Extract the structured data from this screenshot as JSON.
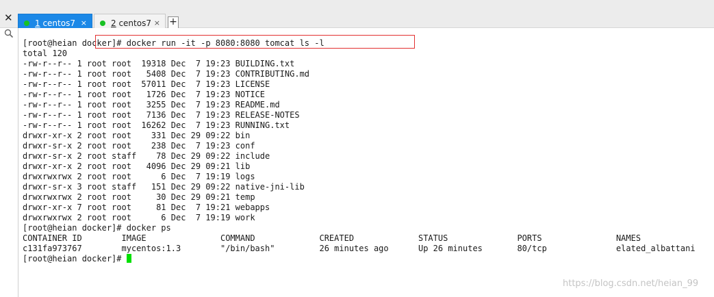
{
  "tabs": [
    {
      "num": "1",
      "name": " centos7",
      "close": "×"
    },
    {
      "num": "2",
      "name": " centos7",
      "close": "×"
    }
  ],
  "add_tab_label": "+",
  "close_panel_label": "✕",
  "icons": {
    "search": "search-icon"
  },
  "prompt": "[root@heian docker]# ",
  "command1": "docker run -it -p 8080:8080 tomcat ls -l",
  "total": "total 120",
  "listing": [
    "-rw-r--r-- 1 root root  19318 Dec  7 19:23 BUILDING.txt",
    "-rw-r--r-- 1 root root   5408 Dec  7 19:23 CONTRIBUTING.md",
    "-rw-r--r-- 1 root root  57011 Dec  7 19:23 LICENSE",
    "-rw-r--r-- 1 root root   1726 Dec  7 19:23 NOTICE",
    "-rw-r--r-- 1 root root   3255 Dec  7 19:23 README.md",
    "-rw-r--r-- 1 root root   7136 Dec  7 19:23 RELEASE-NOTES",
    "-rw-r--r-- 1 root root  16262 Dec  7 19:23 RUNNING.txt",
    "drwxr-xr-x 2 root root    331 Dec 29 09:22 bin",
    "drwxr-sr-x 2 root root    238 Dec  7 19:23 conf",
    "drwxr-sr-x 2 root staff    78 Dec 29 09:22 include",
    "drwxr-xr-x 2 root root   4096 Dec 29 09:21 lib",
    "drwxrwxrwx 2 root root      6 Dec  7 19:19 logs",
    "drwxr-sr-x 3 root staff   151 Dec 29 09:22 native-jni-lib",
    "drwxrwxrwx 2 root root     30 Dec 29 09:21 temp",
    "drwxr-xr-x 7 root root     81 Dec  7 19:21 webapps",
    "drwxrwxrwx 2 root root      6 Dec  7 19:19 work"
  ],
  "command2": "docker ps",
  "ps_header": "CONTAINER ID        IMAGE               COMMAND             CREATED             STATUS              PORTS               NAMES",
  "ps_row": "c131fa973767        mycentos:1.3        \"/bin/bash\"         26 minutes ago      Up 26 minutes       80/tcp              elated_albattani",
  "watermark": "https://blog.csdn.net/heian_99",
  "colors": {
    "tab_active": "#1b88e7",
    "status_dot": "#19c225",
    "cursor": "#00e000",
    "highlight": "#e23030"
  }
}
